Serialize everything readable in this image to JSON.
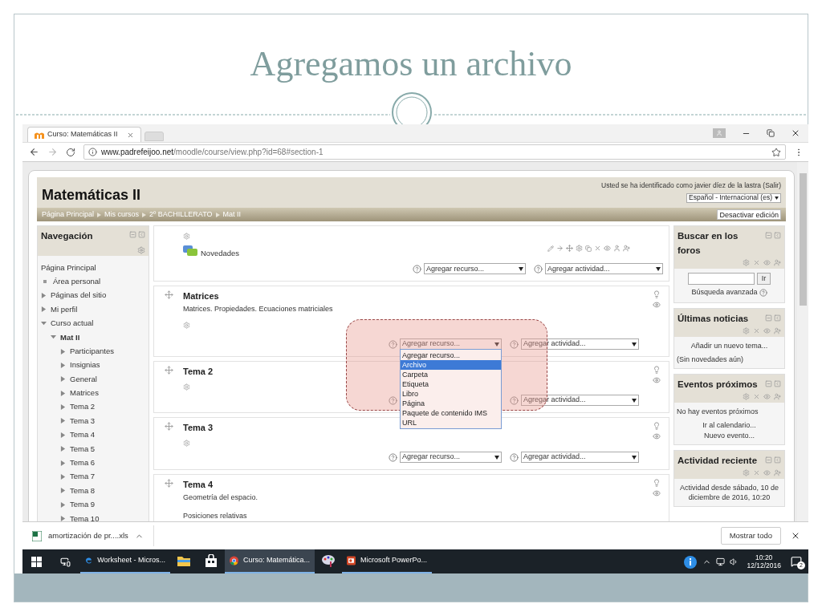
{
  "slide": {
    "title": "Agregamos un archivo"
  },
  "browser": {
    "tab_title": "Curso: Matemáticas II",
    "url_host": "www.padrefeijoo.net",
    "url_path": "/moodle/course/view.php?id=68#section-1"
  },
  "header": {
    "course_title": "Matemáticas II",
    "login_text": "Usted se ha identificado como javier díez de la lastra (Salir)",
    "language": "Español - Internacional (es)",
    "breadcrumb": [
      "Página Principal",
      "Mis cursos",
      "2º BACHILLERATO",
      "Mat II"
    ],
    "edit_button": "Desactivar edición"
  },
  "navigation": {
    "title": "Navegación",
    "items": [
      {
        "label": "Página Principal",
        "kind": "plain"
      },
      {
        "label": "Área personal",
        "kind": "leaf"
      },
      {
        "label": "Páginas del sitio",
        "kind": "branch",
        "expanded": false
      },
      {
        "label": "Mi perfil",
        "kind": "branch",
        "expanded": false
      },
      {
        "label": "Curso actual",
        "kind": "branch",
        "expanded": true,
        "children": [
          {
            "label": "Mat II",
            "kind": "current",
            "expanded": true,
            "children": [
              {
                "label": "Participantes",
                "kind": "branch",
                "expanded": false
              },
              {
                "label": "Insignias",
                "kind": "branch",
                "expanded": false
              },
              {
                "label": "General",
                "kind": "branch",
                "expanded": false
              },
              {
                "label": "Matrices",
                "kind": "branch",
                "expanded": false
              },
              {
                "label": "Tema 2",
                "kind": "branch",
                "expanded": false
              },
              {
                "label": "Tema 3",
                "kind": "branch",
                "expanded": false
              },
              {
                "label": "Tema 4",
                "kind": "branch",
                "expanded": false
              },
              {
                "label": "Tema 5",
                "kind": "branch",
                "expanded": false
              },
              {
                "label": "Tema 6",
                "kind": "branch",
                "expanded": false
              },
              {
                "label": "Tema 7",
                "kind": "branch",
                "expanded": false
              },
              {
                "label": "Tema 8",
                "kind": "branch",
                "expanded": false
              },
              {
                "label": "Tema 9",
                "kind": "branch",
                "expanded": false
              },
              {
                "label": "Tema 10",
                "kind": "branch",
                "expanded": false
              }
            ]
          }
        ]
      }
    ]
  },
  "sections": [
    {
      "kind": "general",
      "activities": [
        {
          "name": "Novedades"
        }
      ],
      "resource_select": "Agregar recurso...",
      "activity_select": "Agregar actividad..."
    },
    {
      "kind": "topic",
      "title": "Matrices",
      "summary": [
        "Matrices. Propiedades. Ecuaciones matriciales"
      ],
      "resource_select": "Agregar recurso...",
      "activity_select": "Agregar actividad...",
      "dropdown": {
        "options": [
          {
            "label": "Agregar recurso...",
            "selected": false
          },
          {
            "label": "Archivo",
            "selected": true
          },
          {
            "label": "Carpeta",
            "selected": false
          },
          {
            "label": "Etiqueta",
            "selected": false
          },
          {
            "label": "Libro",
            "selected": false
          },
          {
            "label": "Página",
            "selected": false
          },
          {
            "label": "Paquete de contenido IMS",
            "selected": false
          },
          {
            "label": "URL",
            "selected": false
          }
        ]
      }
    },
    {
      "kind": "topic",
      "title": "Tema 2",
      "activity_select": "Agregar actividad..."
    },
    {
      "kind": "topic",
      "title": "Tema 3",
      "resource_select": "Agregar recurso...",
      "activity_select": "Agregar actividad..."
    },
    {
      "kind": "topic",
      "title": "Tema 4",
      "summary": [
        "Geometría del espacio.",
        "Posiciones relativas"
      ]
    }
  ],
  "blocks": [
    {
      "title": "Buscar en los foros",
      "kind": "search",
      "button": "Ir",
      "link": "Búsqueda avanzada"
    },
    {
      "title": "Últimas noticias",
      "kind": "lines",
      "lines": [
        {
          "text": "Añadir un nuevo tema...",
          "kind": "link"
        },
        {
          "text": "(Sin novedades aún)",
          "kind": "text"
        }
      ]
    },
    {
      "title": "Eventos próximos",
      "kind": "lines",
      "lines": [
        {
          "text": "No hay eventos próximos",
          "kind": "text"
        },
        {
          "text": "Ir al calendario...",
          "kind": "link"
        },
        {
          "text": "Nuevo evento...",
          "kind": "link"
        }
      ]
    },
    {
      "title": "Actividad reciente",
      "kind": "lines",
      "lines": [
        {
          "text": "Actividad desde sábado, 10 de diciembre de 2016, 10:20",
          "kind": "note"
        }
      ]
    }
  ],
  "downloads": {
    "file": "amortización de pr....xls",
    "show_all": "Mostrar todo"
  },
  "taskbar": {
    "items": [
      {
        "kind": "edge",
        "label": "Worksheet - Micros...",
        "selected": false,
        "running": true
      },
      {
        "kind": "folder",
        "selected": false,
        "running": false
      },
      {
        "kind": "store",
        "selected": false,
        "running": false
      },
      {
        "kind": "chrome",
        "label": "Curso: Matemática...",
        "selected": true,
        "running": true
      },
      {
        "kind": "paint",
        "selected": false,
        "running": false
      },
      {
        "kind": "powerpoint",
        "label": "Microsoft PowerPo...",
        "selected": false,
        "running": true
      }
    ],
    "time": "10:20",
    "date": "12/12/2016",
    "notifications": "2"
  }
}
